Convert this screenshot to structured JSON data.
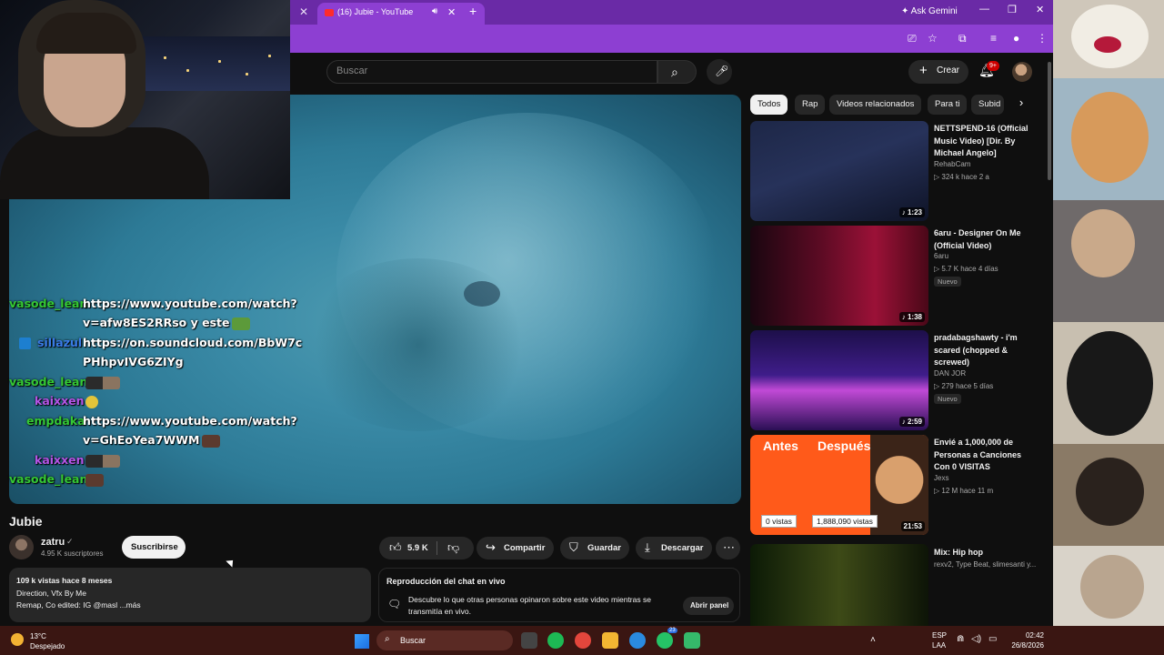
{
  "browser": {
    "tab_title": "(16) Jubie - YouTube",
    "ask_gemini": "Ask Gemini"
  },
  "yt": {
    "search_placeholder": "Buscar",
    "create_label": "Crear",
    "notif_count": "9+"
  },
  "chat": [
    {
      "user": "vasode_lean",
      "color": "#35c935",
      "text": "https://www.youtube.com/watch?",
      "text2": "v=afw8ES2RRso y este",
      "emote": "frog"
    },
    {
      "user": "sillazul",
      "color": "#3a7ce8",
      "text": "https://on.soundcloud.com/BbW7c",
      "text2": "PHhpvIVG6ZIYg",
      "emote": ""
    },
    {
      "user": "vasode_lean",
      "color": "#35c935",
      "text": "",
      "text2": "",
      "emote": "duo"
    },
    {
      "user": "kaixxen",
      "color": "#b455e6",
      "text": "",
      "text2": "",
      "emote": "face"
    },
    {
      "user": "empdaka",
      "color": "#35c935",
      "text": "https://www.youtube.com/watch?",
      "text2": "v=GhEoYea7WWM",
      "emote": "dark"
    },
    {
      "user": "kaixxen",
      "color": "#b455e6",
      "text": "",
      "text2": "",
      "emote": "duo"
    },
    {
      "user": "vasode_lean",
      "color": "#35c935",
      "text": "",
      "text2": "",
      "emote": "dark"
    }
  ],
  "video": {
    "title": "Jubie",
    "channel": "zatru",
    "subscribers": "4.95 K suscriptores",
    "subscribe_label": "Suscribirse",
    "likes": "5.9 K",
    "share_label": "Compartir",
    "save_label": "Guardar",
    "download_label": "Descargar",
    "desc_line1": "109 k vistas  hace 8 meses",
    "desc_line2": "Direction, Vfx By Me",
    "desc_line3": "Remap, Co edited: IG @masl ...más",
    "chat_replay_title": "Reproducción del chat en vivo",
    "chat_replay_text": "Descubre lo que otras personas opinaron sobre este video mientras se transmitía en vivo.",
    "chat_replay_button": "Abrir panel"
  },
  "chips": [
    "Todos",
    "Rap",
    "Videos relacionados",
    "Para ti",
    "Subid"
  ],
  "recs": [
    {
      "title": "NETTSPEND-16 (Official Music Video) [Dir. By Michael Angelo]",
      "channel": "RehabCam",
      "stats": "▷ 324 k  hace 2 a",
      "duration": "1:23",
      "badge": ""
    },
    {
      "title": "6aru - Designer On Me (Official Video)",
      "channel": "6aru",
      "stats": "▷ 5.7 K  hace 4 días",
      "duration": "1:38",
      "badge": "Nuevo"
    },
    {
      "title": "pradabagshawty - i'm scared (chopped & screwed)",
      "channel": "DAN JOR",
      "stats": "▷ 279  hace 5 días",
      "duration": "2:59",
      "badge": "Nuevo"
    },
    {
      "title": "Envié a 1,000,000 de Personas a Canciones Con 0 VISITAS",
      "channel": "Jexs",
      "stats": "▷ 12 M  hace 11 m",
      "duration": "21:53",
      "badge": ""
    },
    {
      "title": "Mix: Hip hop",
      "channel": "rexv2, Type Beat, slimesanti y...",
      "stats": "",
      "duration": "",
      "badge": ""
    }
  ],
  "thumb4": {
    "left_label": "Antes",
    "right_label": "Después",
    "left_box": "0 vistas",
    "right_box": "1,888,090 vistas"
  },
  "taskbar": {
    "temp": "13°C",
    "condition": "Despejado",
    "search": "Buscar",
    "lang1": "ESP",
    "lang2": "LAA",
    "time": "02:42",
    "date": "26/8/2026",
    "whatsapp_badge": "23"
  }
}
